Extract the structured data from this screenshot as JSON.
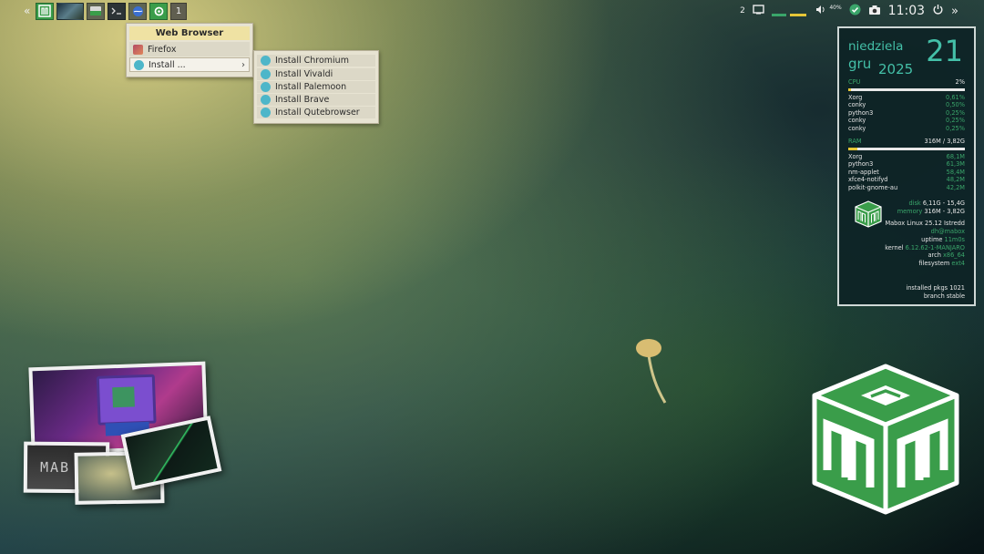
{
  "panel": {
    "left_chevrons": "«",
    "workspace_number": "1",
    "tray_workspace": "2",
    "volume_percent": "40%",
    "clock": "11:03",
    "right_chevrons": "»"
  },
  "menu_web": {
    "title": "Web Browser",
    "items": [
      {
        "label": "Firefox"
      },
      {
        "label": "Install ...",
        "arrow": "›"
      }
    ]
  },
  "menu_install": {
    "items": [
      {
        "label": "Install Chromium"
      },
      {
        "label": "Install Vivaldi"
      },
      {
        "label": "Install Palemoon"
      },
      {
        "label": "Install Brave"
      },
      {
        "label": "Install Qutebrowser"
      }
    ]
  },
  "conky": {
    "day_name": "niedziela",
    "day_number": "21",
    "month": "gru",
    "year": "2025",
    "cpu_label": "CPU",
    "cpu_value": "2%",
    "cpu_fraction": 0.02,
    "cpu_procs": [
      {
        "name": "Xorg",
        "value": "0,61%"
      },
      {
        "name": "conky",
        "value": "0,50%"
      },
      {
        "name": "python3",
        "value": "0,25%"
      },
      {
        "name": "conky",
        "value": "0,25%"
      },
      {
        "name": "conky",
        "value": "0,25%"
      }
    ],
    "ram_label": "RAM",
    "ram_value": "316M / 3,82G",
    "ram_fraction": 0.08,
    "ram_procs": [
      {
        "name": "Xorg",
        "value": "68,1M"
      },
      {
        "name": "python3",
        "value": "61,3M"
      },
      {
        "name": "nm-applet",
        "value": "58,4M"
      },
      {
        "name": "xfce4-notifyd",
        "value": "48,2M"
      },
      {
        "name": "polkit-gnome-au",
        "value": "42,2M"
      }
    ],
    "disk_key": "disk",
    "disk_value": "6,11G - 15,4G",
    "memory_key": "memory",
    "memory_value": "316M - 3,82G",
    "distro": "Mabox Linux 25.12 Istredd",
    "user_host": "dh@mabox",
    "uptime_key": "uptime",
    "uptime_value": "11m0s",
    "kernel_key": "kernel",
    "kernel_value": "6.12.62-1-MANJARO",
    "arch_key": "arch",
    "arch_value": "x86_64",
    "fs_key": "filesystem",
    "fs_value": "ext4",
    "installed_key": "installed pkgs",
    "installed_value": "1021",
    "branch_key": "branch",
    "branch_value": "stable"
  },
  "wallpaper": {
    "collage_text": "MAB"
  },
  "colors": {
    "accent_teal": "#44c0a8",
    "accent_green": "#3aa56a",
    "bar_yellow": "#e6c637",
    "menu_bg": "#e7e3d2",
    "logo_green": "#3a9d4a"
  }
}
